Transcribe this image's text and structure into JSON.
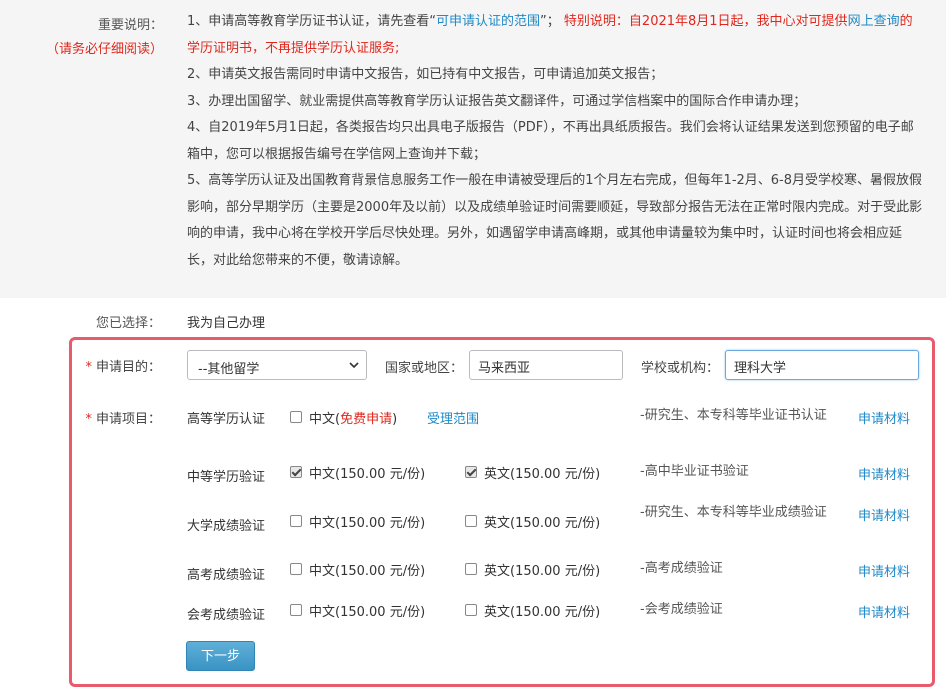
{
  "notice": {
    "label": "重要说明：",
    "sublabel": "（请务必仔细阅读）",
    "item1_prefix": "1、申请高等教育学历证书认证，请先查看“",
    "item1_link": "可申请认证的范围",
    "item1_mid": "”；",
    "item1_special": "特别说明：自2021年8月1日起，我中心对可提供",
    "item1_link2": "网上查询",
    "item1_special2": "的学历证明书，不再提供学历认证服务;",
    "item2": "2、申请英文报告需同时申请中文报告，如已持有中文报告，可申请追加英文报告；",
    "item3": "3、办理出国留学、就业需提供高等教育学历认证报告英文翻译件，可通过学信档案中的国际合作申请办理；",
    "item4": "4、自2019年5月1日起，各类报告均只出具电子版报告（PDF），不再出具纸质报告。我们会将认证结果发送到您预留的电子邮箱中，您可以根据报告编号在学信网上查询并下载；",
    "item5": "5、高等学历认证及出国教育背景信息服务工作一般在申请被受理后的1个月左右完成，但每年1-2月、6-8月受学校寒、暑假放假影响，部分早期学历（主要是2000年及以前）以及成绩单验证时间需要顺延，导致部分报告无法在正常时限内完成。对于受此影响的申请，我中心将在学校开学后尽快处理。另外，如遇留学申请高峰期，或其他申请量较为集中时，认证时间也将会相应延长，对此给您带来的不便，敬请谅解。"
  },
  "chosen": {
    "label": "您已选择：",
    "value": "我为自己办理"
  },
  "form": {
    "purpose_label": "申请目的：",
    "purpose_value": "--其他留学",
    "country_label": "国家或地区：",
    "country_value": "马来西亚",
    "school_label": "学校或机构：",
    "school_value": "理科大学",
    "project_label": "申请项目：",
    "required_mark": "*",
    "next_button": "下一步",
    "rows": [
      {
        "name": "高等学历认证",
        "cn": "中文(",
        "cn_free": "免费申请",
        "cn_close": ")",
        "scope_link": "受理范围",
        "desc": "-研究生、本专科等毕业证书认证",
        "material": "申请材料"
      },
      {
        "name": "中等学历验证",
        "cn": "中文(150.00 元/份)",
        "cn_checked": true,
        "en": "英文(150.00 元/份)",
        "en_checked": true,
        "desc": "-高中毕业证书验证",
        "material": "申请材料"
      },
      {
        "name": "大学成绩验证",
        "cn": "中文(150.00 元/份)",
        "en": "英文(150.00 元/份)",
        "desc": "-研究生、本专科等毕业成绩验证",
        "material": "申请材料"
      },
      {
        "name": "高考成绩验证",
        "cn": "中文(150.00 元/份)",
        "en": "英文(150.00 元/份)",
        "desc": "-高考成绩验证",
        "material": "申请材料"
      },
      {
        "name": "会考成绩验证",
        "cn": "中文(150.00 元/份)",
        "en": "英文(150.00 元/份)",
        "desc": "-会考成绩验证",
        "material": "申请材料"
      }
    ]
  },
  "colors": {
    "accent_red": "#e0271d",
    "link_blue": "#1f8ac8",
    "box_border": "#e85b6c",
    "button": "#3a93c4"
  },
  "icons": {
    "select_arrow": "chevron-down-icon"
  }
}
